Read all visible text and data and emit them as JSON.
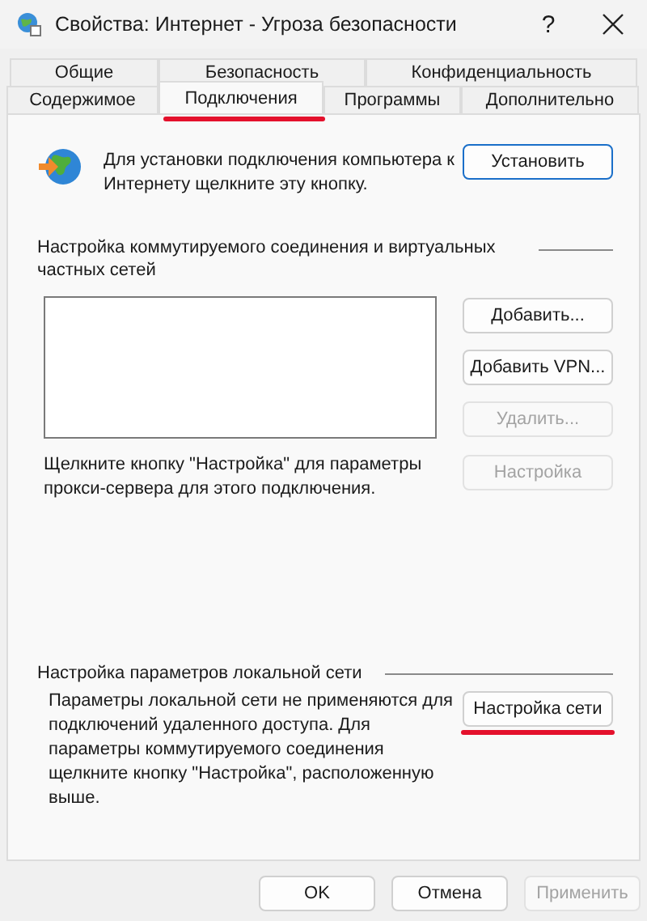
{
  "window": {
    "title": "Свойства: Интернет - Угроза безопасности",
    "help": "?"
  },
  "tab_rows": [
    [
      {
        "label": "Общие",
        "selected": false
      },
      {
        "label": "Безопасность",
        "selected": false
      },
      {
        "label": "Конфиденциальность",
        "selected": false
      }
    ],
    [
      {
        "label": "Содержимое",
        "selected": false
      },
      {
        "label": "Подключения",
        "selected": true,
        "highlighted": true
      },
      {
        "label": "Программы",
        "selected": false
      },
      {
        "label": "Дополнительно",
        "selected": false
      }
    ]
  ],
  "setup": {
    "text": "Для установки подключения компьютера к Интернету щелкните эту кнопку.",
    "button": {
      "label": "Установить",
      "default": true
    }
  },
  "dialup": {
    "heading": "Настройка коммутируемого соединения и виртуальных частных сетей",
    "buttons": [
      {
        "label": "Добавить...",
        "disabled": false
      },
      {
        "label": "Добавить VPN...",
        "disabled": false
      },
      {
        "label": "Удалить...",
        "disabled": true
      }
    ],
    "note": "Щелкните кнопку \"Настройка\" для параметры прокси-сервера для этого подключения.",
    "settings_button": {
      "label": "Настройка",
      "disabled": true
    }
  },
  "lan": {
    "heading": "Настройка параметров локальной сети",
    "text": "Параметры локальной сети не применяются для подключений удаленного доступа. Для параметры коммутируемого соединения щелкните кнопку \"Настройка\", расположенную выше.",
    "button": {
      "label": "Настройка сети",
      "highlighted": true
    }
  },
  "footer": [
    {
      "label": "OK",
      "disabled": false
    },
    {
      "label": "Отмена",
      "disabled": false
    },
    {
      "label": "Применить",
      "disabled": true
    }
  ]
}
